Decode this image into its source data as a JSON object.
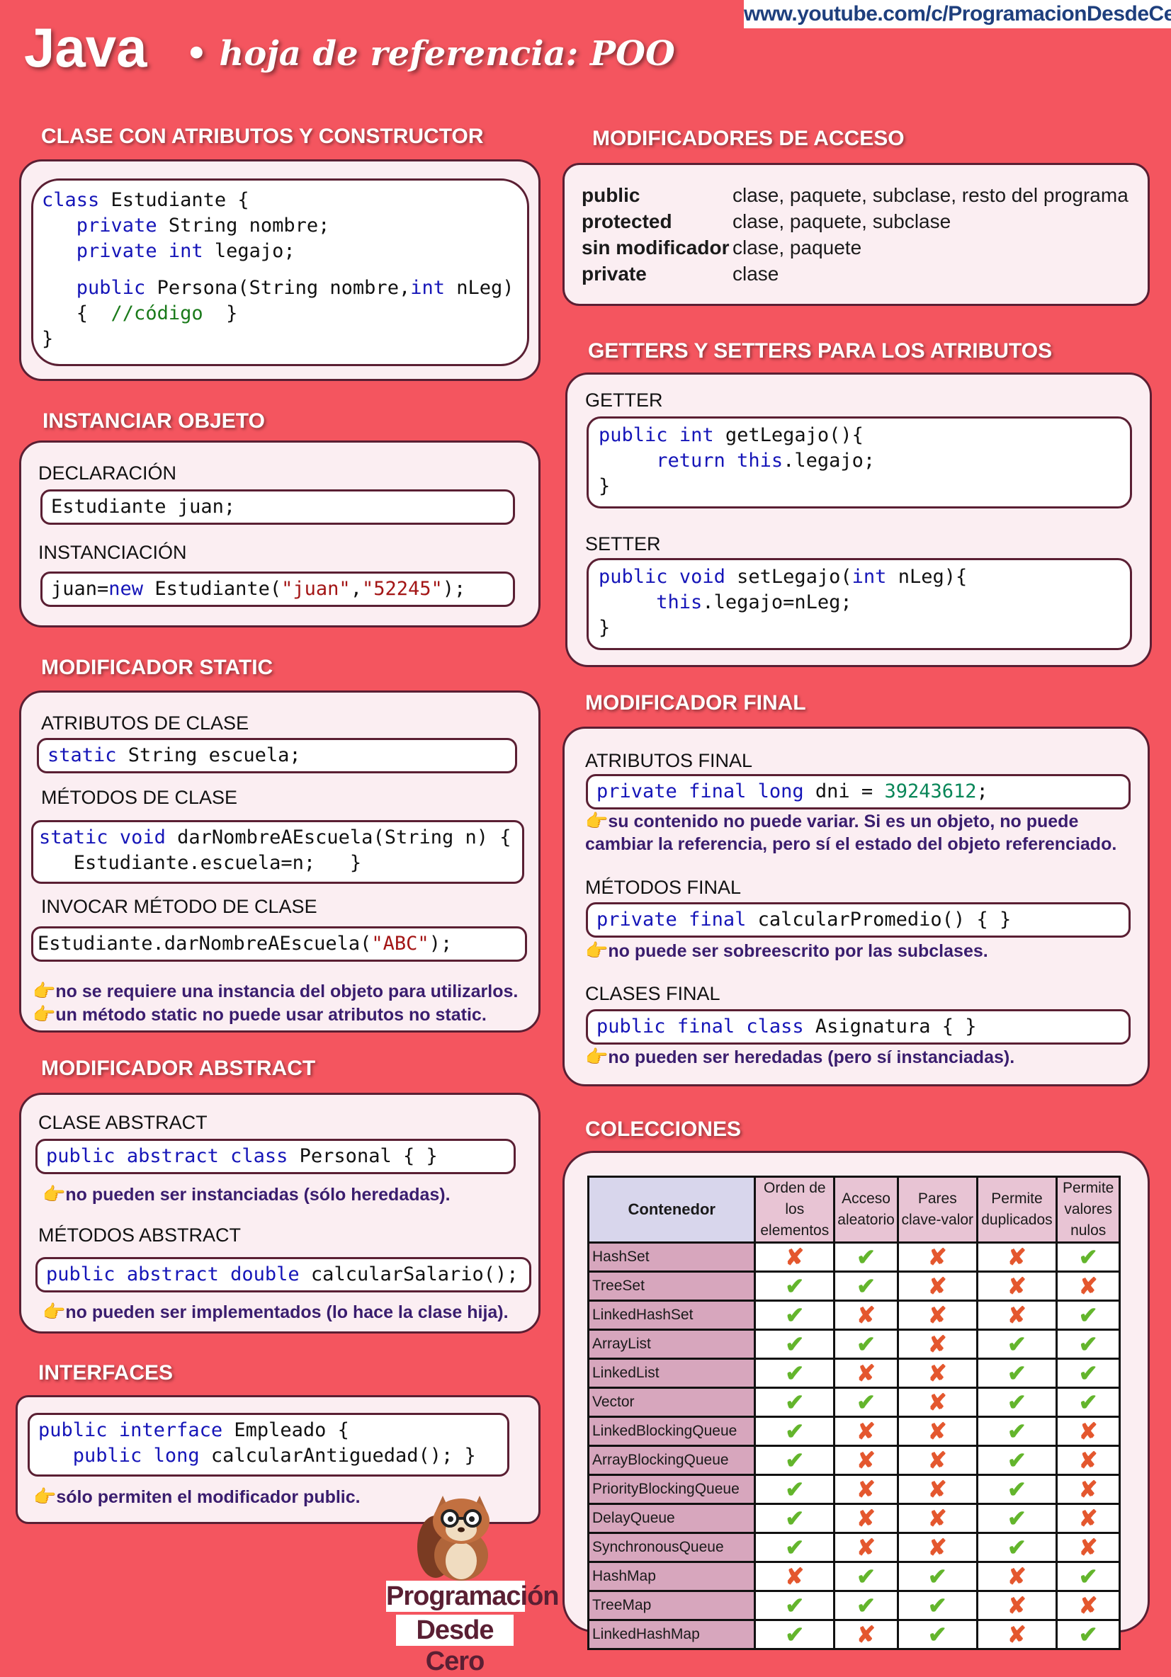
{
  "header": {
    "url": "www.youtube.com/c/ProgramacionDesdeCero",
    "title": "Java",
    "bullet": "•",
    "subtitle": "hoja de referencia: POO"
  },
  "clase": {
    "title": "CLASE CON ATRIBUTOS Y CONSTRUCTOR"
  },
  "instanciar": {
    "title": "INSTANCIAR OBJETO",
    "declaracion_label": "DECLARACIÓN",
    "declaracion_code": "Estudiante juan;",
    "instanciacion_label": "INSTANCIACIÓN"
  },
  "static": {
    "title": "MODIFICADOR STATIC",
    "atributos_label": "ATRIBUTOS DE CLASE",
    "metodos_label": "MÉTODOS DE CLASE",
    "invocar_label": "INVOCAR MÉTODO DE CLASE",
    "note1": "no se requiere una instancia del objeto para utilizarlos.",
    "note2": "un método static no puede usar atributos no static."
  },
  "abstract": {
    "title": "MODIFICADOR ABSTRACT",
    "clase_label": "CLASE ABSTRACT",
    "note1": "no pueden ser instanciadas (sólo heredadas).",
    "metodos_label": "MÉTODOS ABSTRACT",
    "note2": "no pueden ser implementados (lo hace la clase hija)."
  },
  "interfaces": {
    "title": "INTERFACES",
    "note": "sólo permiten el modificador public."
  },
  "acceso": {
    "title": "MODIFICADORES DE ACCESO",
    "rows": [
      {
        "mod": "public",
        "desc": "clase, paquete, subclase, resto del programa"
      },
      {
        "mod": "protected",
        "desc": "clase, paquete, subclase"
      },
      {
        "mod": "sin modificador",
        "desc": "clase, paquete"
      },
      {
        "mod": "private",
        "desc": "clase"
      }
    ]
  },
  "getset": {
    "title": "GETTERS Y SETTERS PARA LOS ATRIBUTOS",
    "getter_label": "GETTER",
    "setter_label": "SETTER"
  },
  "final": {
    "title": "MODIFICADOR FINAL",
    "atributos_label": "ATRIBUTOS FINAL",
    "note1a": "su contenido no puede variar. Si es un objeto, no puede",
    "note1b": "cambiar la referencia, pero sí el estado del objeto referenciado.",
    "metodos_label": "MÉTODOS FINAL",
    "note2": "no puede ser sobreescrito por las subclases.",
    "clases_label": "CLASES FINAL",
    "note3": "no pueden ser heredadas (pero sí instanciadas)."
  },
  "colecciones": {
    "title": "COLECCIONES",
    "headers": [
      "Contenedor",
      "Orden de los elementos",
      "Acceso aleatorio",
      "Pares clave-valor",
      "Permite duplicados",
      "Permite valores nulos"
    ],
    "rows": [
      {
        "name": "HashSet",
        "v": [
          0,
          1,
          0,
          0,
          1
        ]
      },
      {
        "name": "TreeSet",
        "v": [
          1,
          1,
          0,
          0,
          0
        ]
      },
      {
        "name": "LinkedHashSet",
        "v": [
          1,
          0,
          0,
          0,
          1
        ]
      },
      {
        "name": "ArrayList",
        "v": [
          1,
          1,
          0,
          1,
          1
        ]
      },
      {
        "name": "LinkedList",
        "v": [
          1,
          0,
          0,
          1,
          1
        ]
      },
      {
        "name": "Vector",
        "v": [
          1,
          1,
          0,
          1,
          1
        ]
      },
      {
        "name": "LinkedBlockingQueue",
        "v": [
          1,
          0,
          0,
          1,
          0
        ]
      },
      {
        "name": "ArrayBlockingQueue",
        "v": [
          1,
          0,
          0,
          1,
          0
        ]
      },
      {
        "name": "PriorityBlockingQueue",
        "v": [
          1,
          0,
          0,
          1,
          0
        ]
      },
      {
        "name": "DelayQueue",
        "v": [
          1,
          0,
          0,
          1,
          0
        ]
      },
      {
        "name": "SynchronousQueue",
        "v": [
          1,
          0,
          0,
          1,
          0
        ]
      },
      {
        "name": "HashMap",
        "v": [
          0,
          1,
          1,
          0,
          1
        ]
      },
      {
        "name": "TreeMap",
        "v": [
          1,
          1,
          1,
          0,
          0
        ]
      },
      {
        "name": "LinkedHashMap",
        "v": [
          1,
          0,
          1,
          0,
          1
        ]
      }
    ],
    "yes_symbol": "✔",
    "no_symbol": "✘",
    "yes_color": "#63b52c",
    "no_color": "#e4572e"
  },
  "logo": {
    "line1": "Programación",
    "line2": "Desde Cero"
  },
  "icons": {
    "pointing_hand": "👉"
  },
  "colors": {
    "background": "#f4555f",
    "panel": "#fbeef2",
    "border": "#5a1f33",
    "note_text": "#3a1d6e",
    "keyword": "#1515b8",
    "string": "#a31515",
    "comment": "#1a7a1a"
  }
}
